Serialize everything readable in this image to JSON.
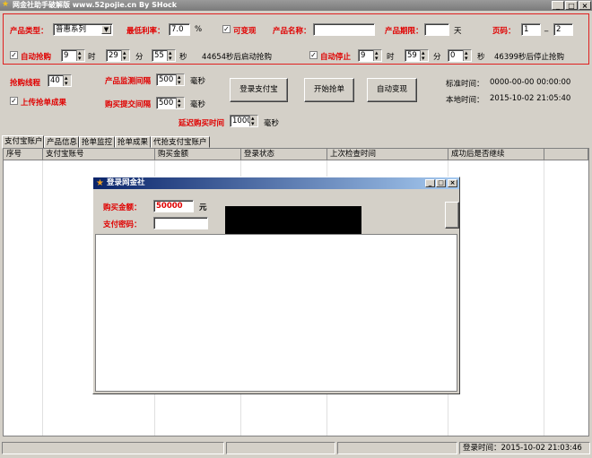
{
  "window": {
    "title": "网金社助手破解版 www.52pojie.cn By SHock",
    "controls": [
      "_",
      "□",
      "×"
    ]
  },
  "config": {
    "product_type_label": "产品类型：",
    "product_type_value": "普惠系列",
    "min_rate_label": "最低利率：",
    "min_rate_value": "7.0",
    "min_rate_unit": "%",
    "transferable_label": "可变现",
    "product_name_label": "产品名称：",
    "product_name_value": "",
    "product_term_label": "产品期限：",
    "product_term_value": "",
    "product_term_unit": "天",
    "page_label": "页码：",
    "page_from": "1",
    "page_sep": "_",
    "page_to": "2",
    "auto_grab_label": "自动抢购",
    "auto_grab_hour": "9",
    "auto_grab_min": "29",
    "auto_grab_sec": "55",
    "unit_hour": "时",
    "unit_min": "分",
    "unit_sec": "秒",
    "auto_grab_note": "44654秒后启动抢购",
    "auto_stop_label": "自动停止",
    "auto_stop_hour": "9",
    "auto_stop_min": "59",
    "auto_stop_sec": "0",
    "auto_stop_note": "46399秒后停止抢购"
  },
  "controls2": {
    "threads_label": "抢购线程",
    "threads_value": "40",
    "upload_label": "上传抢单成果",
    "monitor_interval_label": "产品监测间隔",
    "monitor_interval_value": "500",
    "submit_interval_label": "购买提交间隔",
    "submit_interval_value": "500",
    "unit_ms": "毫秒",
    "delay_label": "延迟购买时间",
    "delay_value": "1000",
    "login_alipay_button": "登录支付宝",
    "start_grab_button": "开始抢单",
    "auto_cash_button": "自动变现",
    "std_time_label": "标准时间：",
    "std_time_value": "0000-00-00 00:00:00",
    "local_time_label": "本地时间：",
    "local_time_value": "2015-10-02 21:05:40"
  },
  "tabs": [
    "支付宝账户",
    "产品信息",
    "抢单监控",
    "抢单成果",
    "代抢支付宝账户"
  ],
  "table": {
    "columns": [
      "序号",
      "支付宝账号",
      "购买金额",
      "登录状态",
      "上次检查时间",
      "成功后是否继续"
    ]
  },
  "dialog": {
    "title": "登录网金社",
    "amount_label": "购买金额：",
    "amount_value": "50000",
    "amount_unit": "元",
    "password_label": "支付密码：",
    "password_value": ""
  },
  "status": {
    "login_time": "登录时间：2015-10-02 21:03:46"
  },
  "colors": {
    "accent_red": "#e00000",
    "dialog_title": "#0a246a"
  }
}
